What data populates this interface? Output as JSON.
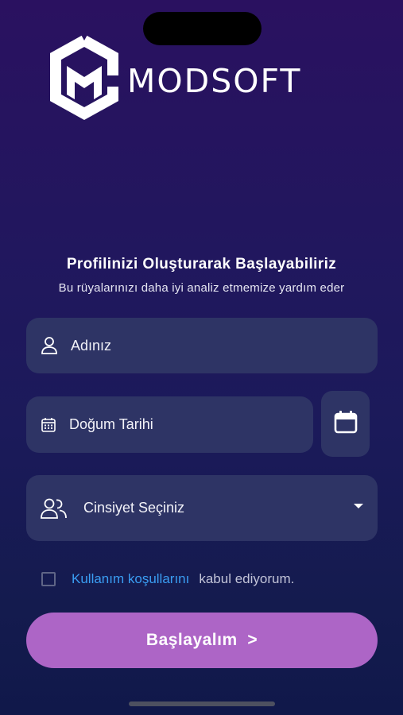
{
  "brand": {
    "name": "MODSOFT"
  },
  "heading": {
    "title": "Profilinizi Oluşturarak Başlayabiliriz",
    "subtitle": "Bu rüyalarınızı daha iyi analiz etmemize yardım eder"
  },
  "form": {
    "name_placeholder": "Adınız",
    "birthdate_placeholder": "Doğum Tarihi",
    "gender_placeholder": "Cinsiyet Seçiniz",
    "terms_link": "Kullanım koşullarını",
    "terms_text": "kabul ediyorum.",
    "terms_checked": false
  },
  "actions": {
    "start_label": "Başlayalım  >"
  },
  "icons": [
    "person-icon",
    "calendar-icon",
    "calendar-picker-icon",
    "people-icon",
    "dropdown-caret-icon"
  ],
  "colors": {
    "primary_button": "#ad65c6",
    "link": "#3a9df2",
    "field_bg": "#2e3465"
  }
}
